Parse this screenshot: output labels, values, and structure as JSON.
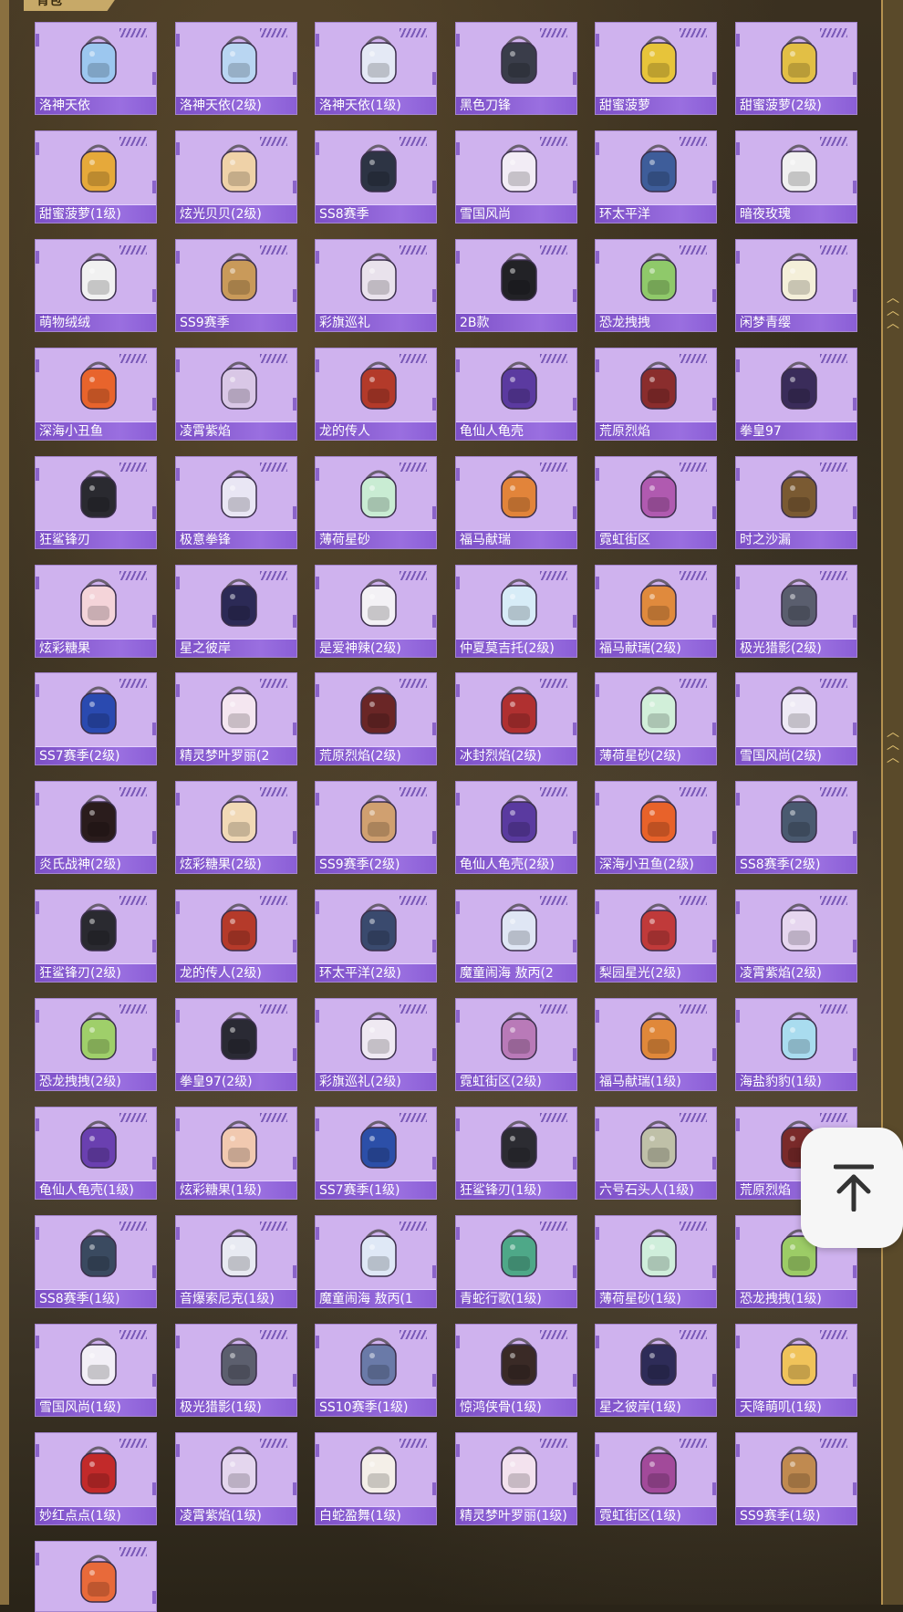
{
  "section_title": "背包",
  "scroll_top_icon": "arrow-up-to-top-icon",
  "colors": {
    "card_bg": "#cfb2ee",
    "label_bg": "#8a5ed6",
    "label_text": "#ffffff",
    "frame_gold": "#c7a968"
  },
  "backpacks": [
    {
      "label": "洛神天依",
      "color": "#9cc7ef"
    },
    {
      "label": "洛神天依(2级)",
      "color": "#b9d6f2"
    },
    {
      "label": "洛神天依(1级)",
      "color": "#e4e9f5"
    },
    {
      "label": "黑色刀锋",
      "color": "#3a3d4a"
    },
    {
      "label": "甜蜜菠萝",
      "color": "#e7c43a"
    },
    {
      "label": "甜蜜菠萝(2级)",
      "color": "#e2bf45"
    },
    {
      "label": "甜蜜菠萝(1级)",
      "color": "#e6a93a"
    },
    {
      "label": "炫光贝贝(2级)",
      "color": "#efd2a8"
    },
    {
      "label": "SS8赛季",
      "color": "#2d3444"
    },
    {
      "label": "雪国风尚",
      "color": "#f2ecf5"
    },
    {
      "label": "环太平洋",
      "color": "#3e5d9a"
    },
    {
      "label": "暗夜玫瑰",
      "color": "#f0f0f0"
    },
    {
      "label": "萌物绒绒",
      "color": "#f1f1f1"
    },
    {
      "label": "SS9赛季",
      "color": "#c99a5a"
    },
    {
      "label": "彩旗巡礼",
      "color": "#e9e2ec"
    },
    {
      "label": "2B款",
      "color": "#222226"
    },
    {
      "label": "恐龙拽拽",
      "color": "#8fc96a"
    },
    {
      "label": "闲梦青缨",
      "color": "#f4efd9"
    },
    {
      "label": "深海小丑鱼",
      "color": "#e8642c"
    },
    {
      "label": "凌霄紫焰",
      "color": "#d9c7e6"
    },
    {
      "label": "龙的传人",
      "color": "#b33a2a"
    },
    {
      "label": "龟仙人龟壳",
      "color": "#5b3aa0"
    },
    {
      "label": "荒原烈焰",
      "color": "#8a2d2d"
    },
    {
      "label": "拳皇97",
      "color": "#3a2c5a"
    },
    {
      "label": "狂鲨锋刃",
      "color": "#2a2a30"
    },
    {
      "label": "极意拳锋",
      "color": "#e9e6f4"
    },
    {
      "label": "薄荷星砂",
      "color": "#c9ecd3"
    },
    {
      "label": "福马献瑞",
      "color": "#e2843a"
    },
    {
      "label": "霓虹街区",
      "color": "#b05ab0"
    },
    {
      "label": "时之沙漏",
      "color": "#7a5a32"
    },
    {
      "label": "炫彩糖果",
      "color": "#f4d4d9"
    },
    {
      "label": "星之彼岸",
      "color": "#2c2a56"
    },
    {
      "label": "是爱神辣(2级)",
      "color": "#f3f1f5"
    },
    {
      "label": "仲夏莫吉托(2级)",
      "color": "#d7ecf7"
    },
    {
      "label": "福马献瑞(2级)",
      "color": "#e08a3d"
    },
    {
      "label": "极光猎影(2级)",
      "color": "#5a5e6e"
    },
    {
      "label": "SS7赛季(2级)",
      "color": "#2a4ab0"
    },
    {
      "label": "精灵梦叶罗丽(2",
      "color": "#f4e6f0"
    },
    {
      "label": "荒原烈焰(2级)",
      "color": "#6a2626"
    },
    {
      "label": "冰封烈焰(2级)",
      "color": "#b03030"
    },
    {
      "label": "薄荷星砂(2级)",
      "color": "#d1efd9"
    },
    {
      "label": "雪国风尚(2级)",
      "color": "#eeeaf5"
    },
    {
      "label": "炎氏战神(2级)",
      "color": "#2a1c1c"
    },
    {
      "label": "炫彩糖果(2级)",
      "color": "#f1d9b6"
    },
    {
      "label": "SS9赛季(2级)",
      "color": "#d0a070"
    },
    {
      "label": "龟仙人龟壳(2级)",
      "color": "#5a3aa0"
    },
    {
      "label": "深海小丑鱼(2级)",
      "color": "#e8622a"
    },
    {
      "label": "SS8赛季(2级)",
      "color": "#4a5a70"
    },
    {
      "label": "狂鲨锋刃(2级)",
      "color": "#2a2a30"
    },
    {
      "label": "龙的传人(2级)",
      "color": "#b53a2a"
    },
    {
      "label": "环太平洋(2级)",
      "color": "#3a4a6e"
    },
    {
      "label": "魔童闹海 敖丙(2",
      "color": "#dfe6f4"
    },
    {
      "label": "梨园星光(2级)",
      "color": "#c03a3a"
    },
    {
      "label": "凌霄紫焰(2级)",
      "color": "#e6d6ef"
    },
    {
      "label": "恐龙拽拽(2级)",
      "color": "#9fcf6a"
    },
    {
      "label": "拳皇97(2级)",
      "color": "#2a2a34"
    },
    {
      "label": "彩旗巡礼(2级)",
      "color": "#efe9f2"
    },
    {
      "label": "霓虹街区(2级)",
      "color": "#b97ab8"
    },
    {
      "label": "福马献瑞(1级)",
      "color": "#e0883a"
    },
    {
      "label": "海盐豹豹(1级)",
      "color": "#a9dcef"
    },
    {
      "label": "龟仙人龟壳(1级)",
      "color": "#6a40b0"
    },
    {
      "label": "炫彩糖果(1级)",
      "color": "#f1c9b0"
    },
    {
      "label": "SS7赛季(1级)",
      "color": "#2c4fa8"
    },
    {
      "label": "狂鲨锋刃(1级)",
      "color": "#2c2c32"
    },
    {
      "label": "六号石头人(1级)",
      "color": "#bfc0a8"
    },
    {
      "label": "荒原烈焰",
      "color": "#7a2a2a"
    },
    {
      "label": "SS8赛季(1级)",
      "color": "#3a4a60"
    },
    {
      "label": "音爆索尼克(1级)",
      "color": "#e8eaf2"
    },
    {
      "label": "魔童闹海 敖丙(1",
      "color": "#dfe8f6"
    },
    {
      "label": "青蛇行歌(1级)",
      "color": "#4ea888"
    },
    {
      "label": "薄荷星砂(1级)",
      "color": "#cfeedb"
    },
    {
      "label": "恐龙拽拽(1级)",
      "color": "#9ccc66"
    },
    {
      "label": "雪国风尚(1级)",
      "color": "#f2eff6"
    },
    {
      "label": "极光猎影(1级)",
      "color": "#5c5f6e"
    },
    {
      "label": "SS10赛季(1级)",
      "color": "#6a7aa8"
    },
    {
      "label": "惊鸿侠骨(1级)",
      "color": "#3a2a26"
    },
    {
      "label": "星之彼岸(1级)",
      "color": "#2e2c58"
    },
    {
      "label": "天降萌叽(1级)",
      "color": "#f0c35a"
    },
    {
      "label": "妙红点点(1级)",
      "color": "#c22a2a"
    },
    {
      "label": "凌霄紫焰(1级)",
      "color": "#e4d6ee"
    },
    {
      "label": "白蛇盈舞(1级)",
      "color": "#f4efe8"
    },
    {
      "label": "精灵梦叶罗丽(1级)",
      "color": "#f3e2ee"
    },
    {
      "label": "霓虹街区(1级)",
      "color": "#a24a9a"
    },
    {
      "label": "SS9赛季(1级)",
      "color": "#c08a50"
    },
    {
      "label": "",
      "color": "#e86a3a"
    }
  ]
}
